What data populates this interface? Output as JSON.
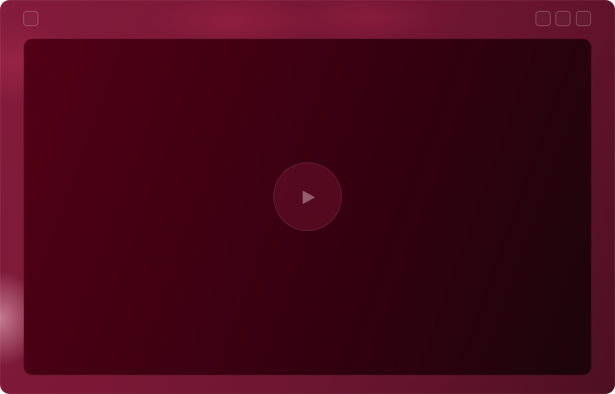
{
  "window": {
    "controls": [
      {
        "name": "menu-button",
        "icon": "square-outline-icon"
      },
      {
        "name": "minimize-button",
        "icon": "square-outline-icon"
      },
      {
        "name": "maximize-button",
        "icon": "square-outline-icon"
      },
      {
        "name": "close-button",
        "icon": "square-outline-icon"
      }
    ]
  },
  "player": {
    "play_icon": "play-icon",
    "state": "paused"
  },
  "colors": {
    "frame": "#7a1836",
    "viewport_start": "#520016",
    "viewport_end": "#1c050b"
  }
}
